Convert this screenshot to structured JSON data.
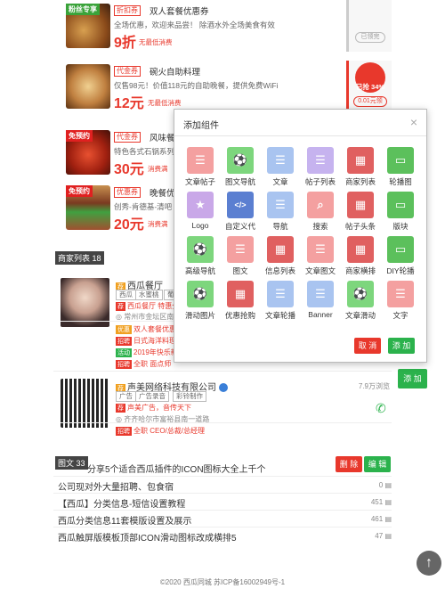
{
  "coupons": [
    {
      "badge": "粉丝专享",
      "tag": "折扣券",
      "title": "双人套餐优惠券",
      "desc": "全场优惠，欢迎来品尝！  除酒水外全场美食有效",
      "price": "9折",
      "note": "无最低消费",
      "side_label": "已领完"
    },
    {
      "badge": "",
      "tag": "代金券",
      "title": "碗火自助料理",
      "desc": "仅售98元！价值118元的自助晚餐，提供免费WiFi",
      "price": "12元",
      "note": "无最低消费",
      "side_label": "已抢 34%",
      "side_btn": "0.01元领"
    },
    {
      "badge": "免预约",
      "tag": "代金券",
      "title": "风味餐厅",
      "desc": "特色各式石锅系列，",
      "price": "30元",
      "note": "消费满"
    },
    {
      "badge": "免预约",
      "tag": "优惠券",
      "title": "晚餐优惠卷",
      "desc": "创秀-肯德基-清吧",
      "price": "20元",
      "note": "消费满"
    }
  ],
  "sections": {
    "shops": "商家列表 18",
    "articles": "图文 33"
  },
  "shop1": {
    "name": "西瓜餐厅",
    "tags": [
      "西瓜",
      "水蜜桃",
      "葡"
    ],
    "promo": "西瓜餐厅 特惠全",
    "addr": "常州市金坛区南南",
    "rows": [
      {
        "tag": "优惠",
        "text": "双人套餐优惠券"
      },
      {
        "tag": "招聘",
        "text": "日式海洋料理"
      },
      {
        "tag": "活动",
        "text": "2019年快乐新"
      },
      {
        "tag": "招聘",
        "text": "全职 面点师"
      }
    ]
  },
  "shop2": {
    "name": "声美网络科技有限公司",
    "views": "7.9万浏览",
    "tags": [
      "广告",
      "广告录音",
      "彩铃制作"
    ],
    "promo": "声美广告，音传天下",
    "addr": "齐齐哈尔市富裕县南一道路",
    "job_tag": "招聘",
    "job": "全职 CEO/总裁/总经理",
    "add_btn": "添 加"
  },
  "modal": {
    "title": "添加组件",
    "close": "×",
    "widgets": [
      {
        "label": "文章帖子",
        "color": "#f4a0a0",
        "icon": "doc-icon"
      },
      {
        "label": "图文导航",
        "color": "#7dd67d",
        "icon": "football-icon"
      },
      {
        "label": "文章",
        "color": "#a9c4f0",
        "icon": "doc-icon"
      },
      {
        "label": "帖子列表",
        "color": "#c6b3ef",
        "icon": "doc-icon"
      },
      {
        "label": "商家列表",
        "color": "#e06060",
        "icon": "xigua-icon"
      },
      {
        "label": "轮播图",
        "color": "#5cc05c",
        "icon": "monitor-icon"
      },
      {
        "label": "Logo",
        "color": "#c9a8e8",
        "icon": "star-icon"
      },
      {
        "label": "自定义代",
        "color": "#5b7fd1",
        "icon": "code-icon"
      },
      {
        "label": "导航",
        "color": "#a9c4f0",
        "icon": "doc-icon"
      },
      {
        "label": "搜索",
        "color": "#f4a0a0",
        "icon": "search-icon"
      },
      {
        "label": "帖子头条",
        "color": "#e06060",
        "icon": "xigua-icon"
      },
      {
        "label": "版块",
        "color": "#5cc05c",
        "icon": "monitor-icon"
      },
      {
        "label": "高级导航",
        "color": "#7dd67d",
        "icon": "football-icon"
      },
      {
        "label": "图文",
        "color": "#f4a0a0",
        "icon": "doc-icon"
      },
      {
        "label": "信息列表",
        "color": "#e06060",
        "icon": "xigua-icon"
      },
      {
        "label": "文章图文",
        "color": "#f4a0a0",
        "icon": "doc-icon"
      },
      {
        "label": "商家横排",
        "color": "#e06060",
        "icon": "xigua-icon"
      },
      {
        "label": "DIY轮播",
        "color": "#5cc05c",
        "icon": "monitor-icon"
      },
      {
        "label": "滑动图片",
        "color": "#7dd67d",
        "icon": "football-icon"
      },
      {
        "label": "优惠抢购",
        "color": "#e06060",
        "icon": "xigua-icon"
      },
      {
        "label": "文章轮播",
        "color": "#a9c4f0",
        "icon": "doc-icon"
      },
      {
        "label": "Banner",
        "color": "#a9c4f0",
        "icon": "doc-icon"
      },
      {
        "label": "文章滑动",
        "color": "#7dd67d",
        "icon": "football-icon"
      },
      {
        "label": "文字",
        "color": "#f4a0a0",
        "icon": "doc-icon"
      }
    ],
    "cancel": "取 消",
    "add": "添 加"
  },
  "article_actions": {
    "delete": "删 除",
    "edit": "编 辑"
  },
  "articles": [
    {
      "title": "分享5个适合西瓜插件的ICON图标大全上千个",
      "count": ""
    },
    {
      "title": "公司现对外大量招聘、包食宿",
      "count": "0"
    },
    {
      "title": "【西瓜】分类信息-短信设置教程",
      "count": "451"
    },
    {
      "title": "西瓜分类信息11套模版设置及展示",
      "count": "461"
    },
    {
      "title": "西瓜触屏版模板顶部ICON滑动图标改成横排5",
      "count": "47"
    }
  ],
  "footer": "©2020 西瓜同城 苏ICP备16002949号-1",
  "colors": {
    "accent_red": "#e8382c",
    "accent_green": "#2bb24c"
  }
}
